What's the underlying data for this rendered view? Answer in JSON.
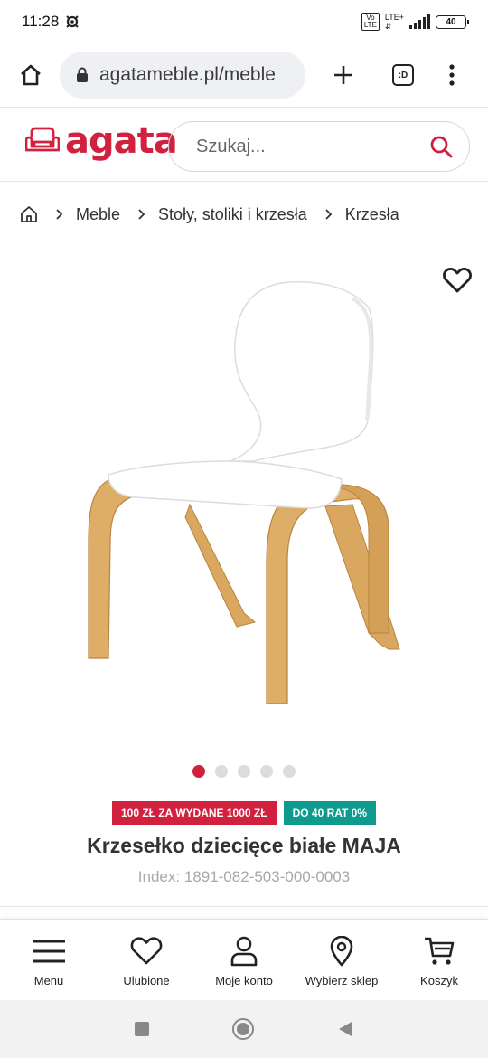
{
  "status_bar": {
    "time": "11:28",
    "network_badge_top": "Vo",
    "network_badge_bottom": "LTE",
    "network_type": "LTE+",
    "battery": "40"
  },
  "browser": {
    "url": "agatameble.pl/meble",
    "tabs_label": ":D",
    "icons": [
      "home-icon",
      "lock-icon",
      "plus-icon",
      "tabs-icon",
      "more-vert-icon"
    ]
  },
  "site": {
    "logo_text": "agata",
    "search_placeholder": "Szukaj...",
    "brand_color": "#d1213f"
  },
  "breadcrumb": {
    "items": [
      "Meble",
      "Stoły, stoliki i krzesła",
      "Krzesła"
    ]
  },
  "carousel": {
    "total": 5,
    "active_index": 0
  },
  "product": {
    "badges": [
      {
        "label": "100 ZŁ ZA WYDANE 1000 ZŁ",
        "color": "#d1213f"
      },
      {
        "label": "DO 40 RAT 0%",
        "color": "#0e9b8d"
      }
    ],
    "title": "Krzesełko dziecięce białe MAJA",
    "index": "Index: 1891-082-503-000-0003"
  },
  "bottom_nav": {
    "items": [
      {
        "label": "Menu",
        "icon": "menu-icon"
      },
      {
        "label": "Ulubione",
        "icon": "heart-icon"
      },
      {
        "label": "Moje konto",
        "icon": "user-icon"
      },
      {
        "label": "Wybierz sklep",
        "icon": "location-pin-icon"
      },
      {
        "label": "Koszyk",
        "icon": "cart-icon"
      }
    ]
  }
}
